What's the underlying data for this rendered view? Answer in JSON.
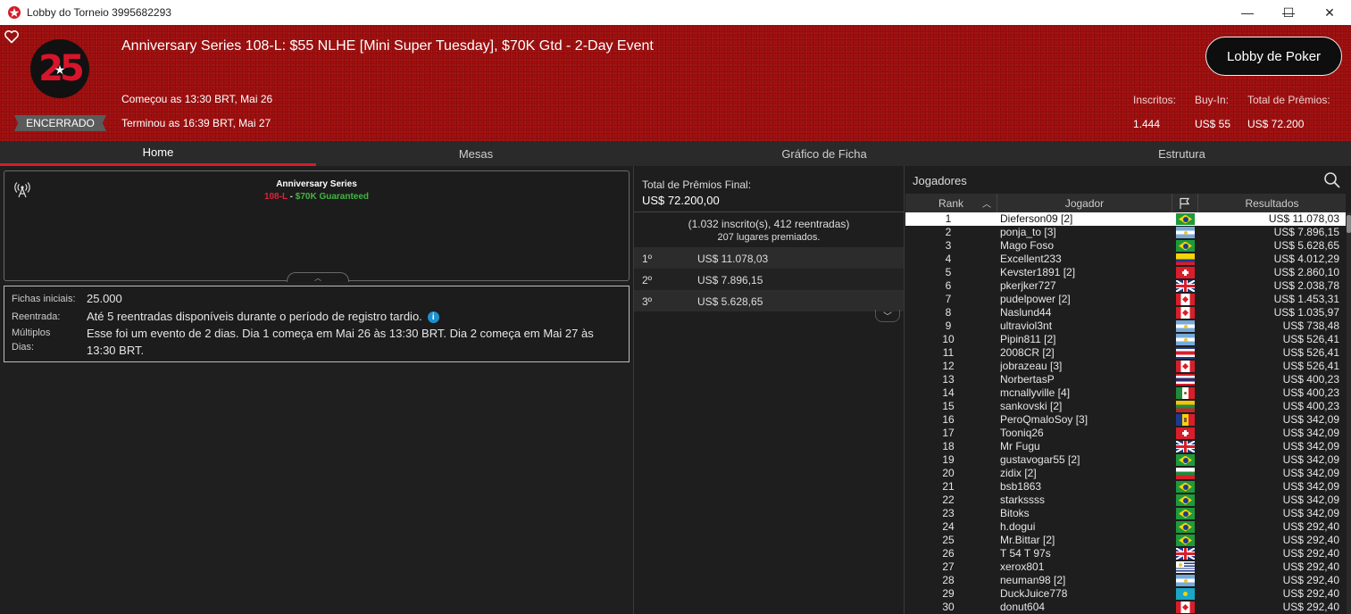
{
  "window": {
    "title": "Lobby do Torneio 3995682293",
    "minimize": "—",
    "maximize": "☐",
    "close": "✕"
  },
  "header": {
    "logo_number": "25",
    "status": "ENCERRADO",
    "event_title": "Anniversary Series 108-L: $55 NLHE [Mini Super Tuesday], $70K Gtd - 2-Day Event",
    "started": "Começou as 13:30 BRT, Mai 26",
    "ended": "Terminou as 16:39 BRT, Mai 27",
    "lobby_button": "Lobby de Poker",
    "stats": {
      "entrants_label": "Inscritos:",
      "entrants": "1.444",
      "buyin_label": "Buy-In:",
      "buyin": "US$ 55",
      "prizepool_label": "Total de Prêmios:",
      "prizepool": "US$ 72.200"
    }
  },
  "tabs": [
    "Home",
    "Mesas",
    "Gráfico de Ficha",
    "Estrutura"
  ],
  "active_tab": "Home",
  "series": {
    "name": "Anniversary Series",
    "code": "108-L",
    "separator": " - ",
    "guarantee": "$70K Guaranteed"
  },
  "info": {
    "starting_chips_label": "Fichas iniciais:",
    "starting_chips": "25.000",
    "reentry_label": "Reentrada:",
    "reentry": "Até 5 reentradas disponíveis durante o período de registro tardio.",
    "multiday_label_1": "Múltiplos",
    "multiday_label_2": "Dias:",
    "multiday_line_1": "Esse foi um evento de 2 dias. Dia 1 começa em Mai 26 às 13:30 BRT. Dia 2 começa em Mai 27 às",
    "multiday_line_2": "13:30 BRT."
  },
  "prizes": {
    "final_label": "Total de Prêmios Final:",
    "final_value": "US$ 72.200,00",
    "entries": "(1.032 inscrito(s), 412 reentradas)",
    "paid": "207 lugares premiados.",
    "places": [
      {
        "place": "1º",
        "amount": "US$ 11.078,03"
      },
      {
        "place": "2º",
        "amount": "US$ 7.896,15"
      },
      {
        "place": "3º",
        "amount": "US$ 5.628,65"
      }
    ]
  },
  "players": {
    "title": "Jogadores",
    "columns": {
      "rank": "Rank",
      "player": "Jogador",
      "results": "Resultados"
    },
    "rows": [
      {
        "rank": "1",
        "name": "Dieferson09 [2]",
        "flag": "br",
        "result": "US$ 11.078,03"
      },
      {
        "rank": "2",
        "name": "ponja_to [3]",
        "flag": "ar",
        "result": "US$ 7.896,15"
      },
      {
        "rank": "3",
        "name": "Mago Foso",
        "flag": "br",
        "result": "US$ 5.628,65"
      },
      {
        "rank": "4",
        "name": "Excellent233",
        "flag": "co",
        "result": "US$ 4.012,29"
      },
      {
        "rank": "5",
        "name": "Kevster1891 [2]",
        "flag": "ch",
        "result": "US$ 2.860,10"
      },
      {
        "rank": "6",
        "name": "pkerjker727",
        "flag": "uk",
        "result": "US$ 2.038,78"
      },
      {
        "rank": "7",
        "name": "pudelpower [2]",
        "flag": "ca",
        "result": "US$ 1.453,31"
      },
      {
        "rank": "8",
        "name": "Naslund44",
        "flag": "ca",
        "result": "US$ 1.035,97"
      },
      {
        "rank": "9",
        "name": "ultraviol3nt",
        "flag": "ar",
        "result": "US$ 738,48"
      },
      {
        "rank": "10",
        "name": "Pipin811 [2]",
        "flag": "ar",
        "result": "US$ 526,41"
      },
      {
        "rank": "11",
        "name": "2008CR [2]",
        "flag": "cr",
        "result": "US$ 526,41"
      },
      {
        "rank": "12",
        "name": "jobrazeau [3]",
        "flag": "ca",
        "result": "US$ 526,41"
      },
      {
        "rank": "13",
        "name": "NorbertasP",
        "flag": "th",
        "result": "US$ 400,23"
      },
      {
        "rank": "14",
        "name": "mcnallyville [4]",
        "flag": "mx",
        "result": "US$ 400,23"
      },
      {
        "rank": "15",
        "name": "sankovski [2]",
        "flag": "lt",
        "result": "US$ 400,23"
      },
      {
        "rank": "16",
        "name": "PeroQmaloSoy [3]",
        "flag": "md",
        "result": "US$ 342,09"
      },
      {
        "rank": "17",
        "name": "Tooniq26",
        "flag": "ch",
        "result": "US$ 342,09"
      },
      {
        "rank": "18",
        "name": "Mr Fugu",
        "flag": "uk",
        "result": "US$ 342,09"
      },
      {
        "rank": "19",
        "name": "gustavogar55 [2]",
        "flag": "br",
        "result": "US$ 342,09"
      },
      {
        "rank": "20",
        "name": "zidix [2]",
        "flag": "bg",
        "result": "US$ 342,09"
      },
      {
        "rank": "21",
        "name": "bsb1863",
        "flag": "br",
        "result": "US$ 342,09"
      },
      {
        "rank": "22",
        "name": "starkssss",
        "flag": "br",
        "result": "US$ 342,09"
      },
      {
        "rank": "23",
        "name": "Bitoks",
        "flag": "br",
        "result": "US$ 342,09"
      },
      {
        "rank": "24",
        "name": "h.dogui",
        "flag": "br",
        "result": "US$ 292,40"
      },
      {
        "rank": "25",
        "name": "Mr.Bittar [2]",
        "flag": "br",
        "result": "US$ 292,40"
      },
      {
        "rank": "26",
        "name": "T 54 T 97s",
        "flag": "uk",
        "result": "US$ 292,40"
      },
      {
        "rank": "27",
        "name": "xerox801",
        "flag": "uy",
        "result": "US$ 292,40"
      },
      {
        "rank": "28",
        "name": "neuman98 [2]",
        "flag": "ar",
        "result": "US$ 292,40"
      },
      {
        "rank": "29",
        "name": "DuckJuice778",
        "flag": "kz",
        "result": "US$ 292,40"
      },
      {
        "rank": "30",
        "name": "donut604",
        "flag": "ca",
        "result": "US$ 292,40"
      }
    ]
  },
  "colors": {
    "header_red": "#a30f0f",
    "accent_red": "#d31d2a",
    "guarantee_green": "#3fb83f"
  }
}
